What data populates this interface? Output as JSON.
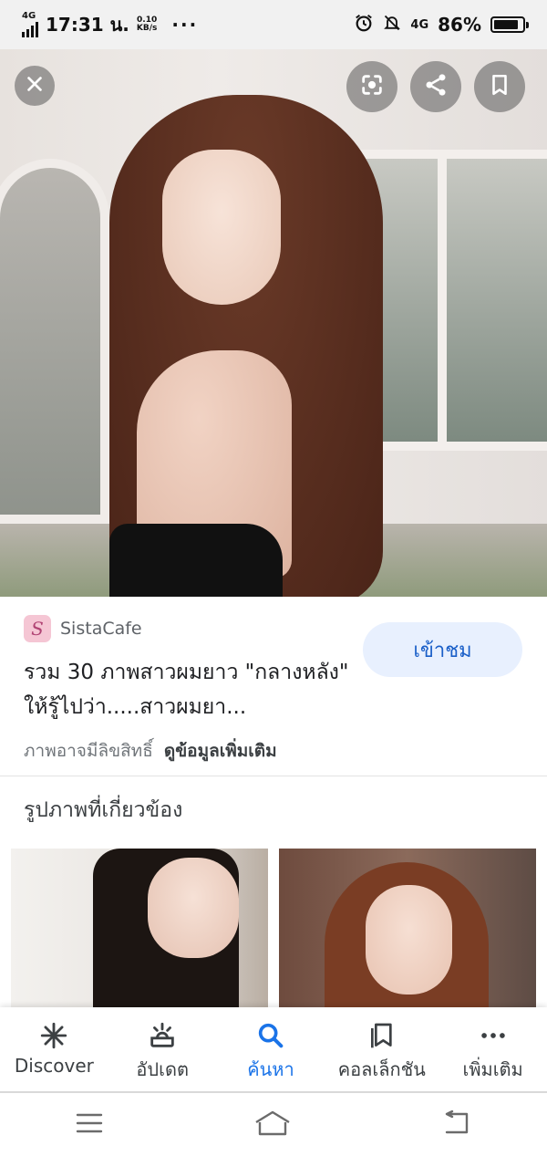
{
  "status_bar": {
    "network": "4G",
    "time": "17:31 น.",
    "speed_value": "0.10",
    "speed_unit": "KB/s",
    "overflow": "···",
    "network_right": "4G",
    "battery": "86%",
    "battery_level": 0.86
  },
  "hero": {
    "close_icon": "close-icon",
    "lens_icon": "google-lens-icon",
    "share_icon": "share-icon",
    "save_icon": "bookmark-icon"
  },
  "result": {
    "source_name": "SistaCafe",
    "source_logo_letter": "S",
    "title": "รวม 30 ภาพสาวผมยาว \"กลางหลัง\" ให้รู้ไปว่า.....สาวผมยา...",
    "visit_label": "เข้าชม",
    "copyright_text": "ภาพอาจมีลิขสิทธิ์",
    "more_info_label": "ดูข้อมูลเพิ่มเติม"
  },
  "related": {
    "heading": "รูปภาพที่เกี่ยวข้อง"
  },
  "bottom_nav": {
    "items": [
      {
        "label": "Discover",
        "icon": "asterisk-icon"
      },
      {
        "label": "อัปเดต",
        "icon": "updates-icon"
      },
      {
        "label": "ค้นหา",
        "icon": "search-icon"
      },
      {
        "label": "คอลเล็กชัน",
        "icon": "collections-icon"
      },
      {
        "label": "เพิ่มเติม",
        "icon": "more-icon"
      }
    ],
    "active_index": 2
  },
  "colors": {
    "accent": "#1a73e8",
    "visit_button_bg": "#e8f0fe",
    "source_logo_bg": "#f5c6d4"
  }
}
